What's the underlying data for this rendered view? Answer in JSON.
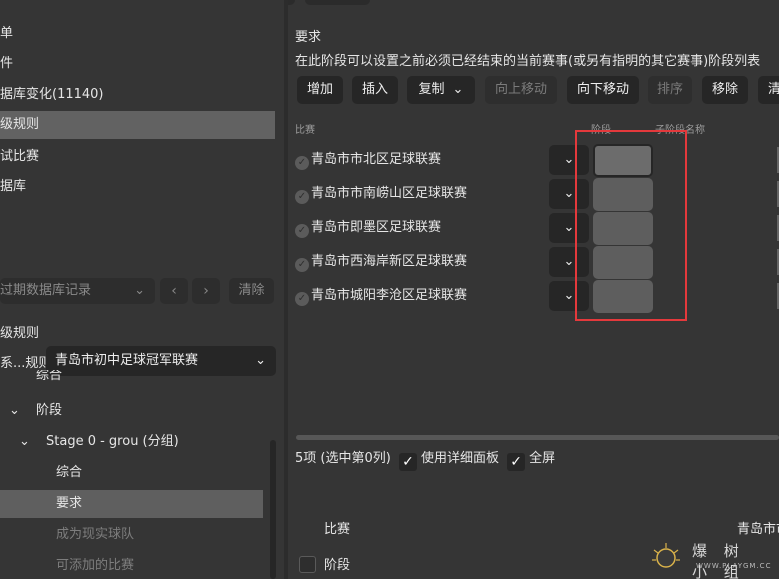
{
  "sidebar": {
    "items": [
      {
        "label": "单"
      },
      {
        "label": "件"
      },
      {
        "label": "据库变化(11140)"
      },
      {
        "label": "级规则"
      },
      {
        "label": "试比赛"
      },
      {
        "label": "据库"
      }
    ],
    "filter_placeholder": "过期数据库记录",
    "prev_label": "‹",
    "next_label": "›",
    "clear_label": "清除",
    "section_title": "级规则",
    "rule_label": "系...规则",
    "rule_value": "青岛市初中足球冠军联赛",
    "tree": [
      {
        "label": "综合",
        "indent": 36,
        "caret": ""
      },
      {
        "label": "阶段",
        "indent": 36,
        "caret": "⌄"
      },
      {
        "label": "Stage 0 - grou (分组)",
        "indent": 46,
        "caret": "⌄"
      },
      {
        "label": "综合",
        "indent": 56,
        "caret": ""
      },
      {
        "label": "要求",
        "indent": 56,
        "caret": ""
      },
      {
        "label": "成为现实球队",
        "indent": 56,
        "caret": ""
      },
      {
        "label": "可添加的比赛",
        "indent": 56,
        "caret": ""
      }
    ]
  },
  "main": {
    "title": "要求",
    "description": "在此阶段可以设置之前必须已经结束的当前赛事(或另有指明的其它赛事)阶段列表",
    "toolbar": {
      "add": "增加",
      "insert": "插入",
      "copy": "复制",
      "move_up": "向上移动",
      "move_down": "向下移动",
      "sort": "排序",
      "remove": "移除",
      "clear": "清"
    },
    "columns": {
      "competition": "比赛",
      "stage": "阶段",
      "substage_name": "子阶段名称"
    },
    "rows": [
      {
        "competition": "青岛市市北区足球联赛"
      },
      {
        "competition": "青岛市市南崂山区足球联赛"
      },
      {
        "competition": "青岛市即墨区足球联赛"
      },
      {
        "competition": "青岛市西海岸新区足球联赛"
      },
      {
        "competition": "青岛市城阳李沧区足球联赛"
      }
    ],
    "status": {
      "count_text": "5项 (选中第0列)",
      "detail_panel_label": "使用详细面板",
      "detail_panel_checked": true,
      "fullscreen_label": "全屏",
      "fullscreen_checked": true
    },
    "detail": {
      "competition_label": "比赛",
      "competition_value": "青岛市市",
      "stage_label": "阶段"
    }
  },
  "watermark": {
    "text": "爆 树 小 组",
    "sub": "WWW.PLAYGM.CC"
  },
  "colors": {
    "background": "#353535",
    "highlight_border": "#e4393c",
    "active_row": "#626262"
  }
}
